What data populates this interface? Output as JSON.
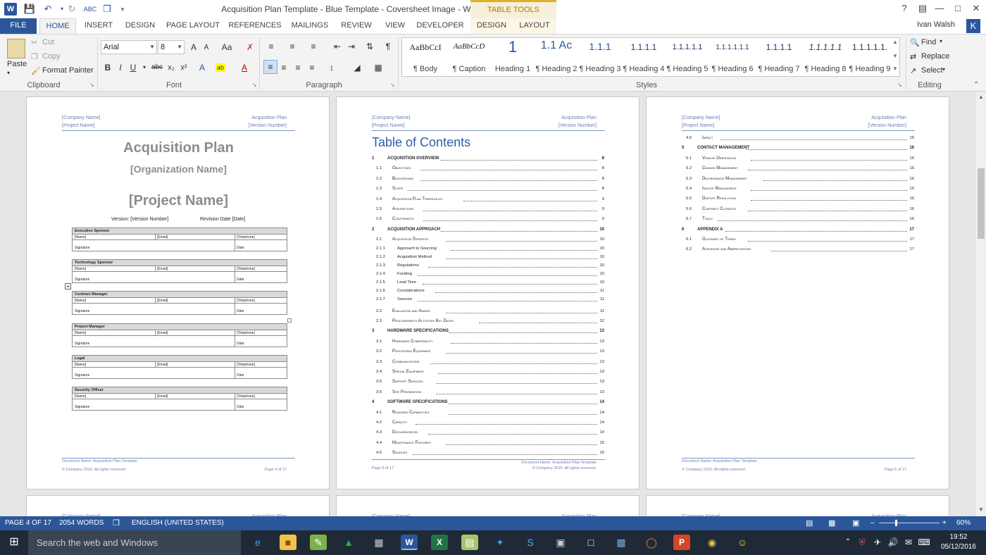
{
  "window": {
    "title": "Acquisition Plan Template - Blue Template - Coversheet Image - Word",
    "contextual_tab_header": "TABLE TOOLS",
    "help": "?",
    "app_icon": "W"
  },
  "tabs": [
    "FILE",
    "HOME",
    "INSERT",
    "DESIGN",
    "PAGE LAYOUT",
    "REFERENCES",
    "MAILINGS",
    "REVIEW",
    "VIEW",
    "DEVELOPER",
    "DESIGN",
    "LAYOUT"
  ],
  "user": {
    "name": "Ivan Walsh",
    "initial": "K"
  },
  "ribbon": {
    "clipboard": {
      "paste": "Paste",
      "cut": "Cut",
      "copy": "Copy",
      "format_painter": "Format Painter",
      "label": "Clipboard"
    },
    "font": {
      "name": "Arial",
      "size": "8",
      "label": "Font",
      "case": "Aa",
      "grow": "A",
      "shrink": "A",
      "bold": "B",
      "italic": "I",
      "underline": "U",
      "strike": "abc",
      "subscript": "x₂",
      "superscript": "x²",
      "effects": "A",
      "color": "A"
    },
    "paragraph": {
      "label": "Paragraph",
      "marks": "¶"
    },
    "styles": {
      "label": "Styles",
      "items": [
        {
          "preview": "AaBbCcI",
          "label": "¶ Body"
        },
        {
          "preview": "AaBbCcD",
          "label": "¶ Caption"
        },
        {
          "preview": "1",
          "label": "Heading 1"
        },
        {
          "preview": "1.1 Ac",
          "label": "¶ Heading 2"
        },
        {
          "preview": "1.1.1",
          "label": "¶ Heading 3"
        },
        {
          "preview": "1.1.1.1",
          "label": "¶ Heading 4"
        },
        {
          "preview": "1.1.1.1.1",
          "label": "¶ Heading 5"
        },
        {
          "preview": "1.1.1.1.1.1",
          "label": "¶ Heading 6"
        },
        {
          "preview": "1.1.1.1",
          "label": "¶ Heading 7"
        },
        {
          "preview": "1.1.1.1.1",
          "label": "¶ Heading 8"
        },
        {
          "preview": "1.1.1.1.1.",
          "label": "¶ Heading 9"
        }
      ]
    },
    "editing": {
      "find": "Find",
      "replace": "Replace",
      "select": "Select",
      "label": "Editing"
    }
  },
  "pages": {
    "header": {
      "company": "[Company Name]",
      "project": "[Project Name]",
      "doc": "Acquisition Plan",
      "version": "[Version Number]"
    },
    "footer": {
      "doc_name": "Document Name: Acquisition Plan Template",
      "copyright": "© Company 2016. All rights reserved.",
      "p4": "Page 4 of 17",
      "p5": "Page 5 of 17",
      "p6": "Page 6 of 17"
    },
    "cover": {
      "title": "Acquisition Plan",
      "org": "[Organization Name]",
      "project": "[Project Name]",
      "version": "Version: [Version Number]",
      "revision": "Revision Date [Date]",
      "roles": [
        "Executive Sponsor",
        "Technology Sponsor",
        "Contract Manager",
        "Project Manager",
        "Legal",
        "Security Officer"
      ],
      "cells": {
        "name": "[Name]",
        "email": "[Email]",
        "phone": "[Telephone]",
        "signature": "Signature",
        "date": "Date"
      }
    },
    "toc_title": "Table of Contents",
    "toc_page5": [
      {
        "num": "1",
        "text": "ACQUISITION OVERVIEW",
        "page": "8",
        "lvl": 1
      },
      {
        "num": "1.1",
        "text": "Objectives",
        "page": "8",
        "lvl": 2
      },
      {
        "num": "1.2",
        "text": "Background",
        "page": "8",
        "lvl": 2
      },
      {
        "num": "1.3",
        "text": "Scope",
        "page": "8",
        "lvl": 2
      },
      {
        "num": "1.4",
        "text": "Acquisition Plan Thresholds",
        "page": "9",
        "lvl": 2
      },
      {
        "num": "1.5",
        "text": "Assumptions",
        "page": "9",
        "lvl": 2
      },
      {
        "num": "1.6",
        "text": "Constraints",
        "page": "9",
        "lvl": 2
      },
      {
        "num": "2",
        "text": "ACQUISITION APPROACH",
        "page": "10",
        "lvl": 1
      },
      {
        "num": "2.1",
        "text": "Acquisition Strategy",
        "page": "10",
        "lvl": 2
      },
      {
        "num": "2.1.1",
        "text": "Approach to Sourcing",
        "page": "10",
        "lvl": 3
      },
      {
        "num": "2.1.2",
        "text": "Acquisition Method",
        "page": "10",
        "lvl": 3
      },
      {
        "num": "2.1.3",
        "text": "Regulations",
        "page": "10",
        "lvl": 3
      },
      {
        "num": "2.1.4",
        "text": "Funding",
        "page": "10",
        "lvl": 3
      },
      {
        "num": "2.1.5",
        "text": "Lead Time",
        "page": "10",
        "lvl": 3
      },
      {
        "num": "2.1.6",
        "text": "Considerations",
        "page": "11",
        "lvl": 3
      },
      {
        "num": "2.1.7",
        "text": "Sources",
        "page": "11",
        "lvl": 3
      },
      {
        "num": "2.2",
        "text": "Evaluation and Award",
        "page": "11",
        "lvl": 2
      },
      {
        "num": "2.3",
        "text": "Procurements Activities Key Dates",
        "page": "12",
        "lvl": 2
      },
      {
        "num": "3",
        "text": "HARDWARE SPECIFICATIONS",
        "page": "13",
        "lvl": 1
      },
      {
        "num": "3.1",
        "text": "Hardware Compatibility",
        "page": "13",
        "lvl": 2
      },
      {
        "num": "3.2",
        "text": "Processing Equipment",
        "page": "13",
        "lvl": 2
      },
      {
        "num": "3.3",
        "text": "Communications",
        "page": "13",
        "lvl": 2
      },
      {
        "num": "3.4",
        "text": "Special Equipment",
        "page": "13",
        "lvl": 2
      },
      {
        "num": "3.5",
        "text": "Support Services",
        "page": "13",
        "lvl": 2
      },
      {
        "num": "3.6",
        "text": "Site Preparation",
        "page": "13",
        "lvl": 2
      },
      {
        "num": "4",
        "text": "SOFTWARE SPECIFICATIONS",
        "page": "14",
        "lvl": 1
      },
      {
        "num": "4.1",
        "text": "Required Capabilities",
        "page": "14",
        "lvl": 2
      },
      {
        "num": "4.2",
        "text": "Capacity",
        "page": "14",
        "lvl": 2
      },
      {
        "num": "4.3",
        "text": "Documentation",
        "page": "14",
        "lvl": 2
      },
      {
        "num": "4.4",
        "text": "Maintenance Features",
        "page": "15",
        "lvl": 2
      },
      {
        "num": "4.5",
        "text": "Sources",
        "page": "15",
        "lvl": 2
      }
    ],
    "toc_page6": [
      {
        "num": "4.6",
        "text": "Impact",
        "page": "15",
        "lvl": 2
      },
      {
        "num": "5",
        "text": "CONTACT MANAGEMENT",
        "page": "16",
        "lvl": 1
      },
      {
        "num": "5.1",
        "text": "Vendor Orientation",
        "page": "16",
        "lvl": 2
      },
      {
        "num": "5.2",
        "text": "Change Management",
        "page": "16",
        "lvl": 2
      },
      {
        "num": "5.3",
        "text": "Deliverables Management",
        "page": "16",
        "lvl": 2
      },
      {
        "num": "5.4",
        "text": "Invoice Management",
        "page": "16",
        "lvl": 2
      },
      {
        "num": "5.5",
        "text": "Dispute Resolution",
        "page": "16",
        "lvl": 2
      },
      {
        "num": "5.6",
        "text": "Contract Closeout",
        "page": "16",
        "lvl": 2
      },
      {
        "num": "5.7",
        "text": "Tools",
        "page": "16",
        "lvl": 2
      },
      {
        "num": "6",
        "text": "APPENDIX A",
        "page": "17",
        "lvl": 1
      },
      {
        "num": "6.1",
        "text": "Glossary of Terms",
        "page": "17",
        "lvl": 2
      },
      {
        "num": "6.2",
        "text": "Acronyms and Abbreviations",
        "page": "17",
        "lvl": 2
      }
    ]
  },
  "status": {
    "page": "PAGE 4 OF 17",
    "words": "2054 WORDS",
    "language": "ENGLISH (UNITED STATES)",
    "zoom": "60%",
    "zoom_level": 0.6
  },
  "taskbar": {
    "search": "Search the web and Windows",
    "time": "19:52",
    "date": "05/12/2016"
  },
  "colors": {
    "word_blue": "#2b579a",
    "toc_blue": "#2e5ea8",
    "table_tools": "#e2ad2a"
  }
}
